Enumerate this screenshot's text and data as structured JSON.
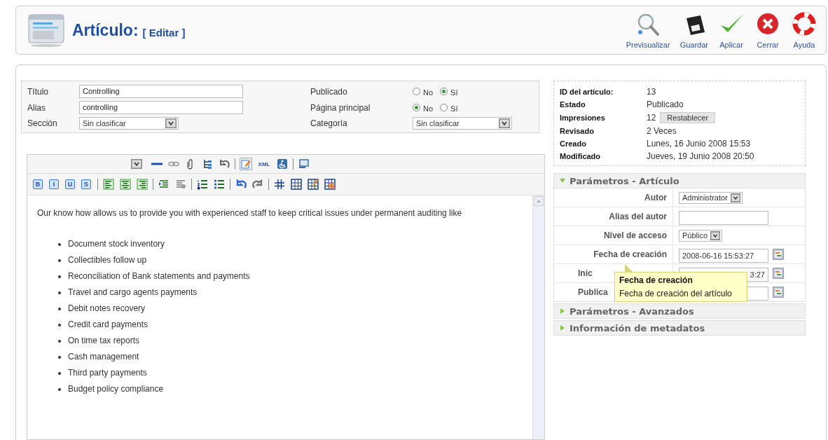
{
  "header": {
    "title": "Artículo:",
    "subtitle": "[ Editar ]"
  },
  "toolbar": [
    {
      "kind": "preview",
      "label": "Previsualizar"
    },
    {
      "kind": "save",
      "label": "Guardar"
    },
    {
      "kind": "apply",
      "label": "Aplicar"
    },
    {
      "kind": "close",
      "label": "Cerrar"
    },
    {
      "kind": "help",
      "label": "Ayuda"
    }
  ],
  "form": {
    "left_fields": [
      {
        "kind": "text",
        "label": "Título",
        "value": "Controlling"
      },
      {
        "kind": "text",
        "label": "Alias",
        "value": "controlling"
      },
      {
        "kind": "select",
        "label": "Sección",
        "value": "Sin clasificar"
      }
    ],
    "right_fields": [
      {
        "kind": "radio",
        "label": "Publicado",
        "options": [
          {
            "label": "No",
            "selected": false
          },
          {
            "label": "Sí",
            "selected": true
          }
        ]
      },
      {
        "kind": "radio",
        "label": "Página principal",
        "options": [
          {
            "label": "No",
            "selected": true
          },
          {
            "label": "Sí",
            "selected": false
          }
        ]
      },
      {
        "kind": "select",
        "label": "Categoría",
        "value": "Sin clasificar"
      }
    ]
  },
  "editor": {
    "xml_button": "XML",
    "source_toggled": true,
    "format_buttons": [
      "B",
      "I",
      "U",
      "S"
    ],
    "intro": "Our know how allows us to provide you with experienced staff to keep critical issues under permanent auditing like",
    "items": [
      "Document stock inventory",
      "Collectibles follow up",
      "Reconciliation of Bank statements and payments",
      "Travel and cargo agents payments",
      "Debit notes recovery",
      "Credit card payments",
      "On time tax reports",
      "Cash management",
      "Third party payments",
      "Budget policy compliance"
    ]
  },
  "info": {
    "rows": [
      {
        "label": "ID del artículo:",
        "value": "13"
      },
      {
        "label": "Estado",
        "value": "Publicado"
      },
      {
        "label": "Impresiones",
        "value": "12",
        "button": "Restablecer"
      },
      {
        "label": "Revisado",
        "value": "2 Veces"
      },
      {
        "label": "Creado",
        "value": "Lunes, 16 Junio 2008 15:53"
      },
      {
        "label": "Modificado",
        "value": "Jueves, 19 Junio 2008 20:50"
      }
    ]
  },
  "panels": [
    {
      "title": "Parámetros - Artículo",
      "expanded": true,
      "rows": [
        {
          "kind": "select",
          "label": "Autor",
          "value": "Administrator"
        },
        {
          "kind": "text",
          "label": "Alias del autor"
        },
        {
          "kind": "select",
          "label": "Nivel de acceso",
          "value": "Público"
        },
        {
          "kind": "date",
          "label": "Fecha de creación",
          "value": "2008-06-16 15:53:27"
        },
        {
          "kind": "date",
          "label": "Inic",
          "value": "3:27",
          "partial": true
        },
        {
          "kind": "date",
          "label": "Publica",
          "partial": true
        }
      ],
      "tooltip": {
        "title": "Fecha de creación",
        "text": "Fecha de creación del artículo"
      }
    },
    {
      "title": "Parámetros - Avanzados",
      "expanded": false
    },
    {
      "title": "Información de metadatos",
      "expanded": false
    }
  ]
}
